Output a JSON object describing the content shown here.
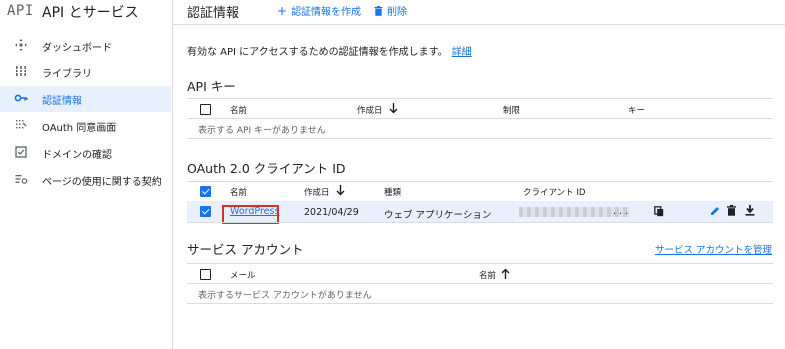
{
  "sidebar": {
    "logo": "API",
    "title": "API とサービス",
    "items": [
      {
        "label": "ダッシュボード",
        "icon": "dashboard-icon"
      },
      {
        "label": "ライブラリ",
        "icon": "library-icon"
      },
      {
        "label": "認証情報",
        "icon": "key-icon",
        "active": true
      },
      {
        "label": "OAuth 同意画面",
        "icon": "oauth-consent-icon"
      },
      {
        "label": "ドメインの確認",
        "icon": "checkbox-icon"
      },
      {
        "label": "ページの使用に関する契約",
        "icon": "settings-list-icon"
      }
    ]
  },
  "header": {
    "title": "認証情報",
    "create_label": "認証情報を作成",
    "delete_label": "削除"
  },
  "description": {
    "text": "有効な API にアクセスするための認証情報を作成します。",
    "link": "詳細"
  },
  "api_keys": {
    "title": "API キー",
    "columns": [
      "名前",
      "作成日",
      "制限",
      "キー"
    ],
    "empty": "表示する API キーがありません"
  },
  "oauth": {
    "title": "OAuth 2.0 クライアント ID",
    "columns": [
      "名前",
      "作成日",
      "種類",
      "クライアント ID"
    ],
    "rows": [
      {
        "name": "WordPress",
        "created": "2021/04/29",
        "type": "ウェブ アプリケーション",
        "client_id_suffix": ". . ."
      }
    ]
  },
  "service_accounts": {
    "title": "サービス アカウント",
    "manage_link": "サービス アカウントを管理",
    "columns": [
      "メール",
      "名前"
    ],
    "empty": "表示するサービス アカウントがありません"
  },
  "colors": {
    "accent": "#1a73e8",
    "highlight": "#e8f0fe",
    "annotation": "#d93025"
  }
}
